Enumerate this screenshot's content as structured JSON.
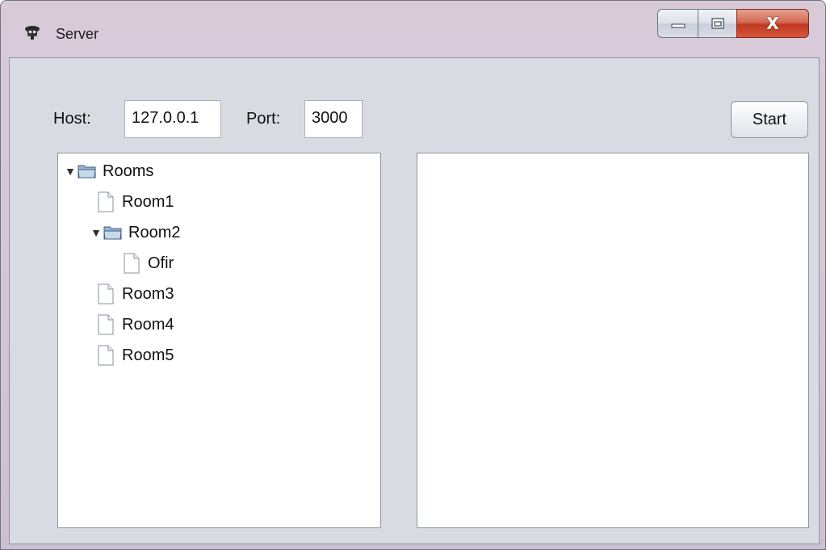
{
  "window": {
    "title": "Server",
    "controls": {
      "minimize_icon": "minimize-icon",
      "maximize_icon": "maximize-icon",
      "close_glyph": "X"
    }
  },
  "toolbar": {
    "host_label": "Host:",
    "host_value": "127.0.0.1",
    "port_label": "Port:",
    "port_value": "3000",
    "start_label": "Start"
  },
  "tree": {
    "root": {
      "label": "Rooms",
      "expanded": true,
      "icon": "folder-open-icon"
    },
    "rooms": [
      {
        "label": "Room1",
        "icon": "file-icon"
      },
      {
        "label": "Room2",
        "expanded": true,
        "icon": "folder-open-icon"
      },
      {
        "label": "Ofir",
        "icon": "file-icon"
      },
      {
        "label": "Room3",
        "icon": "file-icon"
      },
      {
        "label": "Room4",
        "icon": "file-icon"
      },
      {
        "label": "Room5",
        "icon": "file-icon"
      }
    ]
  },
  "colors": {
    "titlebar": "#d7c9d7",
    "client_bg": "#d8dbe1",
    "close_button": "#c9452c",
    "panel_bg": "#ffffff"
  }
}
